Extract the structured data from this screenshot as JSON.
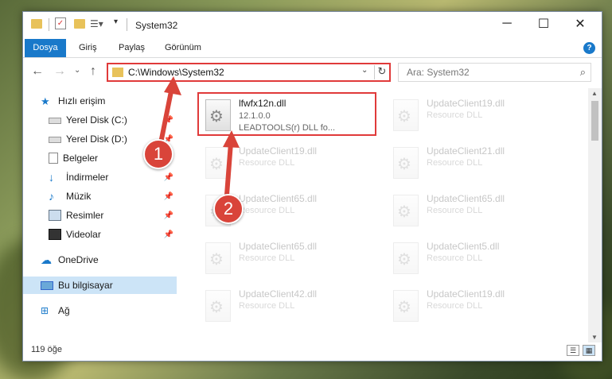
{
  "window": {
    "title": "System32",
    "controls": {
      "minimize": "─",
      "maximize": "☐",
      "close": "✕"
    }
  },
  "ribbon": {
    "tabs": [
      "Dosya",
      "Giriş",
      "Paylaş",
      "Görünüm"
    ],
    "help": "?"
  },
  "address": {
    "path": "C:\\Windows\\System32",
    "dropdown": "⌄",
    "refresh": "↻"
  },
  "search": {
    "placeholder": "Ara: System32",
    "icon": "search-icon"
  },
  "sidebar": {
    "items": [
      {
        "label": "Hızlı erişim",
        "icon": "star-icon",
        "pinned": false
      },
      {
        "label": "Yerel Disk (C:)",
        "icon": "drive-icon",
        "pinned": true
      },
      {
        "label": "Yerel Disk (D:)",
        "icon": "drive-icon",
        "pinned": true
      },
      {
        "label": "Belgeler",
        "icon": "documents-icon",
        "pinned": true
      },
      {
        "label": "İndirmeler",
        "icon": "download-icon",
        "pinned": true
      },
      {
        "label": "Müzik",
        "icon": "music-icon",
        "pinned": true
      },
      {
        "label": "Resimler",
        "icon": "pictures-icon",
        "pinned": true
      },
      {
        "label": "Videolar",
        "icon": "video-icon",
        "pinned": true
      },
      {
        "label": "OneDrive",
        "icon": "cloud-icon",
        "pinned": false
      },
      {
        "label": "Bu bilgisayar",
        "icon": "computer-icon",
        "pinned": false,
        "selected": true
      },
      {
        "label": "Ağ",
        "icon": "network-icon",
        "pinned": false
      }
    ]
  },
  "files": {
    "featured": {
      "name": "lfwfx12n.dll",
      "version": "12.1.0.0",
      "description": "LEADTOOLS(r) DLL fo..."
    },
    "left_column": [
      {
        "name": "UpdateClient19.dll",
        "type": "Resource DLL"
      },
      {
        "name": "UpdateClient65.dll",
        "type": "Resource DLL"
      },
      {
        "name": "UpdateClient65.dll",
        "type": "Resource DLL"
      },
      {
        "name": "UpdateClient42.dll",
        "type": "Resource DLL"
      }
    ],
    "right_column": [
      {
        "name": "UpdateClient19.dll",
        "type": "Resource DLL"
      },
      {
        "name": "UpdateClient21.dll",
        "type": "Resource DLL"
      },
      {
        "name": "UpdateClient65.dll",
        "type": "Resource DLL"
      },
      {
        "name": "UpdateClient5.dll",
        "type": "Resource DLL"
      },
      {
        "name": "UpdateClient19.dll",
        "type": "Resource DLL"
      }
    ]
  },
  "status": {
    "count": "119 öğe"
  },
  "callouts": [
    "1",
    "2"
  ],
  "colors": {
    "accent": "#1979ca",
    "highlight": "#e03a3a",
    "callout": "#d9443a",
    "selected": "#cce4f7"
  }
}
